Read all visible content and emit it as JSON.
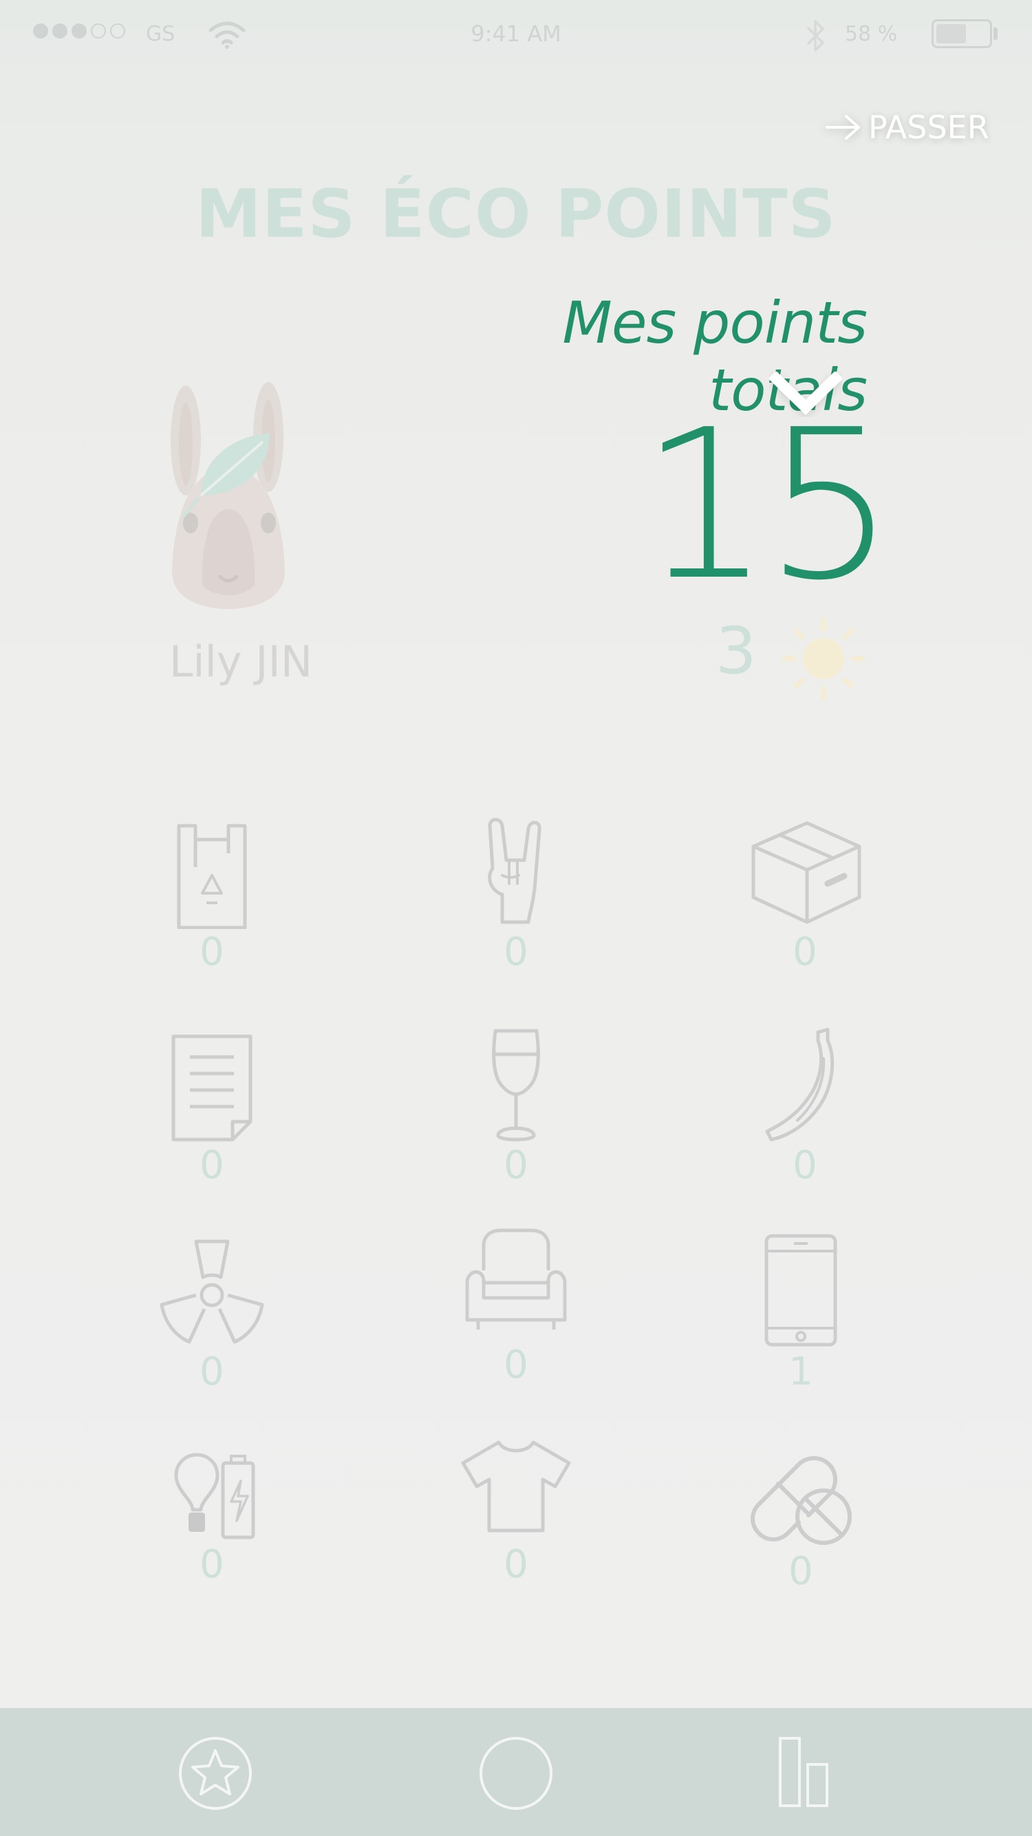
{
  "status_bar": {
    "carrier": "GS",
    "time": "9:41 AM",
    "battery": "58 %",
    "battery_level": 0.58,
    "signal_bars": 3,
    "signal_total": 5
  },
  "skip_label": "PASSER",
  "page_title": "MES ÉCO POINTS",
  "subtitle": "Mes points totals",
  "total_points": "15",
  "user_name": "Lily JIN",
  "suns_count": "3",
  "categories": [
    {
      "icon": "plastic-bag-icon",
      "value": "0"
    },
    {
      "icon": "rock-hand-icon",
      "value": "0"
    },
    {
      "icon": "cardboard-box-icon",
      "value": "0"
    },
    {
      "icon": "paper-document-icon",
      "value": "0"
    },
    {
      "icon": "wine-glass-icon",
      "value": "0"
    },
    {
      "icon": "banana-icon",
      "value": "0"
    },
    {
      "icon": "radioactive-icon",
      "value": "0"
    },
    {
      "icon": "armchair-icon",
      "value": "0"
    },
    {
      "icon": "smartphone-icon",
      "value": "1"
    },
    {
      "icon": "bulb-battery-icon",
      "value": "0"
    },
    {
      "icon": "tshirt-icon",
      "value": "0"
    },
    {
      "icon": "pills-icon",
      "value": "0"
    }
  ],
  "nav": [
    {
      "icon": "star-circle-icon"
    },
    {
      "icon": "circle-icon"
    },
    {
      "icon": "bar-chart-icon"
    }
  ],
  "colors": {
    "accent": "#21916c",
    "faded_accent": "#cde0da",
    "icon_stroke": "#cdcdcd",
    "navbar": "#ced8d5"
  }
}
